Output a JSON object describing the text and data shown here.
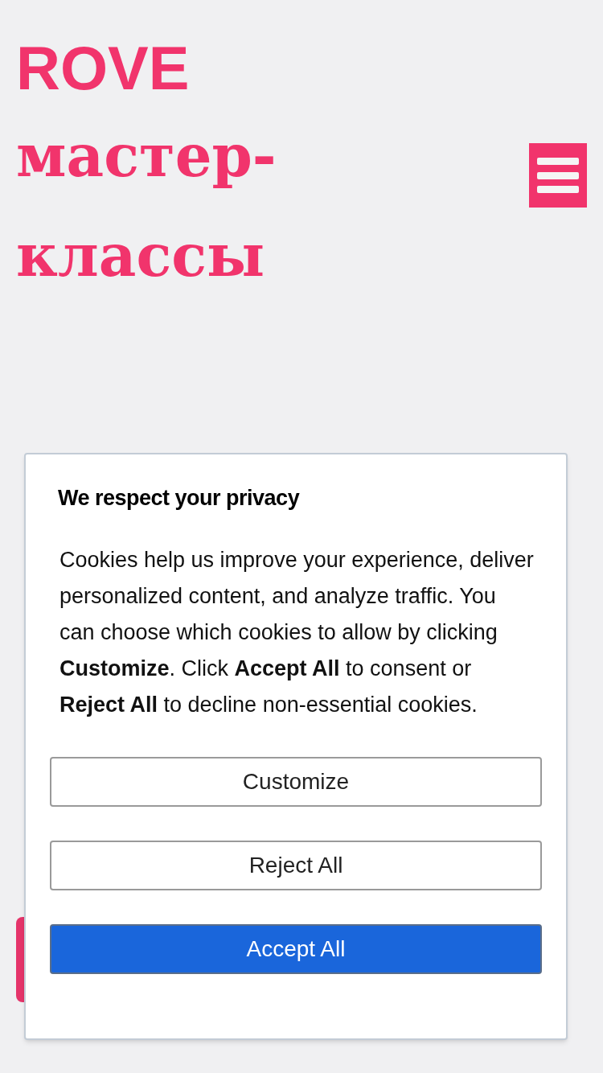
{
  "header": {
    "logo_top": "ROVE",
    "logo_bottom": "мастер-классы"
  },
  "cookie_dialog": {
    "title": "We respect your privacy",
    "body": "Cookies help us improve your experience, deliver personalized content, and analyze traffic. You can choose which cookies to allow by clicking **Customize**. Click **Accept All** to consent or **Reject All** to decline non-essential cookies.",
    "buttons": [
      {
        "label": "Customize",
        "kind": "outline"
      },
      {
        "label": "Reject All",
        "kind": "outline"
      },
      {
        "label": "Accept All",
        "kind": "primary"
      }
    ]
  }
}
